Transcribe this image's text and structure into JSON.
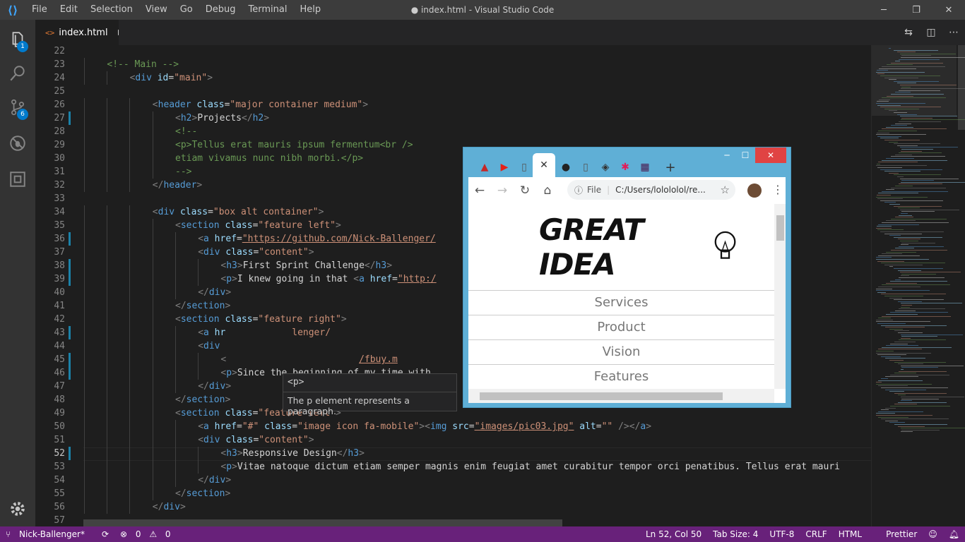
{
  "window": {
    "title": "● index.html - Visual Studio Code",
    "menu": [
      "File",
      "Edit",
      "Selection",
      "View",
      "Go",
      "Debug",
      "Terminal",
      "Help"
    ]
  },
  "activity": {
    "explorer_badge": "1",
    "scm_badge": "6"
  },
  "tab": {
    "icon": "<>",
    "label": "index.html"
  },
  "editor": {
    "lines": [
      {
        "n": "22",
        "h": ""
      },
      {
        "n": "23",
        "h": "<span class='cm'>&lt;!-- Main --&gt;</span>",
        "i": 2
      },
      {
        "n": "24",
        "h": "<span class='t'>&lt;</span><span class='tn'>div</span> <span class='an'>id</span>=<span class='av'>\"main\"</span><span class='t'>&gt;</span>",
        "i": 3
      },
      {
        "n": "25",
        "h": ""
      },
      {
        "n": "26",
        "h": "<span class='t'>&lt;</span><span class='tn'>header</span> <span class='an'>class</span>=<span class='av'>\"major container medium\"</span><span class='t'>&gt;</span>",
        "i": 4
      },
      {
        "n": "27",
        "h": "<span class='t'>&lt;</span><span class='tn'>h2</span><span class='t'>&gt;</span>Projects<span class='t'>&lt;/</span><span class='tn'>h2</span><span class='t'>&gt;</span>",
        "i": 5,
        "m": 1
      },
      {
        "n": "28",
        "h": "<span class='cm'>&lt;!--</span>",
        "i": 5
      },
      {
        "n": "29",
        "h": "<span class='cm'>&lt;p&gt;Tellus erat mauris ipsum fermentum&lt;br /&gt;</span>",
        "i": 5
      },
      {
        "n": "30",
        "h": "<span class='cm'>etiam vivamus nunc nibh morbi.&lt;/p&gt;</span>",
        "i": 5
      },
      {
        "n": "31",
        "h": "<span class='cm'>--&gt;</span>",
        "i": 5
      },
      {
        "n": "32",
        "h": "<span class='t'>&lt;/</span><span class='tn'>header</span><span class='t'>&gt;</span>",
        "i": 4
      },
      {
        "n": "33",
        "h": ""
      },
      {
        "n": "34",
        "h": "<span class='t'>&lt;</span><span class='tn'>div</span> <span class='an'>class</span>=<span class='av'>\"box alt container\"</span><span class='t'>&gt;</span>",
        "i": 4
      },
      {
        "n": "35",
        "h": "<span class='t'>&lt;</span><span class='tn'>section</span> <span class='an'>class</span>=<span class='av'>\"feature left\"</span><span class='t'>&gt;</span>",
        "i": 5
      },
      {
        "n": "36",
        "h": "<span class='t'>&lt;</span><span class='tn'>a</span> <span class='an'>href</span>=<span class='av u'>\"https://github.com/Nick-Ballenger/</span>                                          <span class='av'> fa-signal\"</span><span class='t'>&gt;&lt;</span><span class='tn'>in</span>",
        "i": 6,
        "m": 1
      },
      {
        "n": "37",
        "h": "<span class='t'>&lt;</span><span class='tn'>div</span> <span class='an'>class</span>=<span class='av'>\"content\"</span><span class='t'>&gt;</span>",
        "i": 6
      },
      {
        "n": "38",
        "h": "<span class='t'>&lt;</span><span class='tn'>h3</span><span class='t'>&gt;</span>First Sprint Challenge<span class='t'>&lt;/</span><span class='tn'>h3</span><span class='t'>&gt;</span>",
        "i": 7,
        "m": 1
      },
      {
        "n": "39",
        "h": "<span class='t'>&lt;</span><span class='tn'>p</span><span class='t'>&gt;</span>I knew going in that <span class='t'>&lt;</span><span class='tn'>a</span> <span class='an'>href</span>=<span class='av u'>\"http:/</span>                                           ys I never expe",
        "i": 7,
        "m": 1
      },
      {
        "n": "40",
        "h": "<span class='t'>&lt;/</span><span class='tn'>div</span><span class='t'>&gt;</span>",
        "i": 6
      },
      {
        "n": "41",
        "h": "<span class='t'>&lt;/</span><span class='tn'>section</span><span class='t'>&gt;</span>",
        "i": 5
      },
      {
        "n": "42",
        "h": "<span class='t'>&lt;</span><span class='tn'>section</span> <span class='an'>class</span>=<span class='av'>\"feature right\"</span><span class='t'>&gt;</span>",
        "i": 5
      },
      {
        "n": "43",
        "h": "<span class='t'>&lt;</span><span class='tn'>a</span> <span class='an'>hr</span>            <span class='av'>lenger/</span>                                           <span class='av u'>c02.jpg\"</span> <span class='an'>alt</span>=<span class='av'>\"\"</span>",
        "i": 6,
        "m": 1
      },
      {
        "n": "44",
        "h": "<span class='t'>&lt;</span><span class='tn'>div</span>",
        "i": 6
      },
      {
        "n": "45",
        "h": "<span class='t'>&lt;</span>                        <span class='av u'>/fbuy.m</span>",
        "i": 7,
        "m": 1
      },
      {
        "n": "46",
        "h": "<span class='t'>&lt;</span><span class='tn'>p</span><span class='t'>&gt;</span>Since the beginning of my time with                                             s me that I was",
        "i": 7,
        "m": 1
      },
      {
        "n": "47",
        "h": "<span class='t'>&lt;/</span><span class='tn'>div</span><span class='t'>&gt;</span>",
        "i": 6
      },
      {
        "n": "48",
        "h": "<span class='t'>&lt;/</span><span class='tn'>section</span><span class='t'>&gt;</span>",
        "i": 5
      },
      {
        "n": "49",
        "h": "<span class='t'>&lt;</span><span class='tn'>section</span> <span class='an'>class</span>=<span class='av'>\"feature left\"</span><span class='t'>&gt;</span>",
        "i": 5
      },
      {
        "n": "50",
        "h": "<span class='t'>&lt;</span><span class='tn'>a</span> <span class='an'>href</span>=<span class='av'>\"#\"</span> <span class='an'>class</span>=<span class='av'>\"image icon fa-mobile\"</span><span class='t'>&gt;&lt;</span><span class='tn'>img</span> <span class='an'>src</span>=<span class='av u'>\"images/pic03.jpg\"</span> <span class='an'>alt</span>=<span class='av'>\"\"</span> <span class='t'>/&gt;&lt;/</span><span class='tn'>a</span><span class='t'>&gt;</span>",
        "i": 6
      },
      {
        "n": "51",
        "h": "<span class='t'>&lt;</span><span class='tn'>div</span> <span class='an'>class</span>=<span class='av'>\"content\"</span><span class='t'>&gt;</span>",
        "i": 6
      },
      {
        "n": "52",
        "h": "<span class='t'>&lt;</span><span class='tn'>h3</span><span class='t'>&gt;</span>Responsive Design<span class='t'>&lt;/</span><span class='tn'>h3</span><span class='t'>&gt;</span>",
        "i": 7,
        "m": 1,
        "c": 1
      },
      {
        "n": "53",
        "h": "<span class='t'>&lt;</span><span class='tn'>p</span><span class='t'>&gt;</span>Vitae natoque dictum etiam semper magnis enim feugiat amet curabitur tempor orci penatibus. Tellus erat mauri",
        "i": 7
      },
      {
        "n": "54",
        "h": "<span class='t'>&lt;/</span><span class='tn'>div</span><span class='t'>&gt;</span>",
        "i": 6
      },
      {
        "n": "55",
        "h": "<span class='t'>&lt;/</span><span class='tn'>section</span><span class='t'>&gt;</span>",
        "i": 5
      },
      {
        "n": "56",
        "h": "<span class='t'>&lt;/</span><span class='tn'>div</span><span class='t'>&gt;</span>",
        "i": 4
      },
      {
        "n": "57",
        "h": ""
      }
    ]
  },
  "hover": {
    "tag": "<p>",
    "description": "The p element represents a paragraph."
  },
  "status": {
    "branch": "Nick-Ballenger*",
    "errors": "0",
    "warnings": "0",
    "position": "Ln 52, Col 50",
    "tab_size": "Tab Size: 4",
    "encoding": "UTF-8",
    "eol": "CRLF",
    "language": "HTML",
    "formatter": "Prettier"
  },
  "browser": {
    "address_scheme": "File",
    "address": "C:/Users/lolololol/re...",
    "logo_text": "GREAT IDEA",
    "nav": [
      "Services",
      "Product",
      "Vision",
      "Features"
    ]
  },
  "colors": {
    "statusbar": "#68217a",
    "accent": "#007acc",
    "chrome_frame": "#5fafd6"
  }
}
